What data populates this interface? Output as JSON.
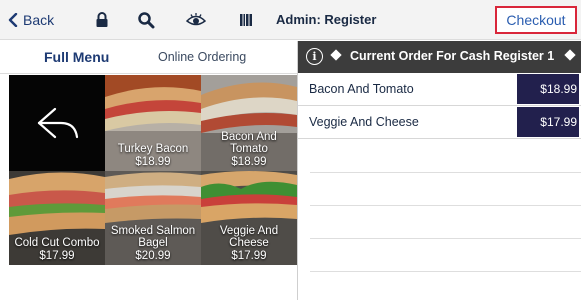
{
  "toolbar": {
    "back_label": "Back",
    "title": "Admin: Register",
    "checkout_label": "Checkout",
    "icons": [
      "chevron-left-icon",
      "lock-icon",
      "search-icon",
      "eye-icon",
      "barcode-icon"
    ],
    "highlight_color": "#d9263a"
  },
  "menu": {
    "tabs": [
      {
        "label": "Full Menu",
        "active": true
      },
      {
        "label": "Online Ordering",
        "active": false
      }
    ],
    "back_tile_icon": "reply-arrow-icon",
    "items": [
      {
        "name": "Turkey Bacon",
        "price": "$18.99"
      },
      {
        "name": "Bacon And Tomato",
        "price": "$18.99"
      },
      {
        "name": "Cold Cut Combo",
        "price": "$17.99"
      },
      {
        "name": "Smoked Salmon Bagel",
        "price": "$20.99"
      },
      {
        "name": "Veggie And Cheese",
        "price": "$17.99"
      }
    ]
  },
  "order": {
    "info_icon": "info-icon",
    "title": "Current Order For Cash Register 1",
    "items": [
      {
        "name": "Bacon And Tomato",
        "price": "$18.99"
      },
      {
        "name": "Veggie And Cheese",
        "price": "$17.99"
      }
    ],
    "price_badge_color": "#22204d",
    "header_color": "#3c3c3c"
  }
}
